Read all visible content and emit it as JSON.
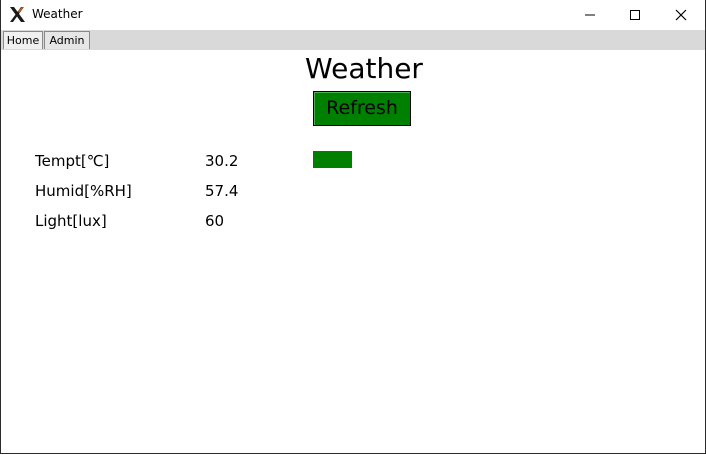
{
  "window": {
    "title": "Weather",
    "icon": "x-logo-icon"
  },
  "tabs": [
    {
      "label": "Home"
    },
    {
      "label": "Admin"
    }
  ],
  "main": {
    "title": "Weather",
    "refresh_label": "Refresh",
    "readings": [
      {
        "label": "Tempt[℃]",
        "value": "30.2"
      },
      {
        "label": "Humid[%RH]",
        "value": "57.4"
      },
      {
        "label": "Light[lux]",
        "value": "60"
      }
    ],
    "indicator_color": "#008000",
    "button_color": "#008000"
  }
}
